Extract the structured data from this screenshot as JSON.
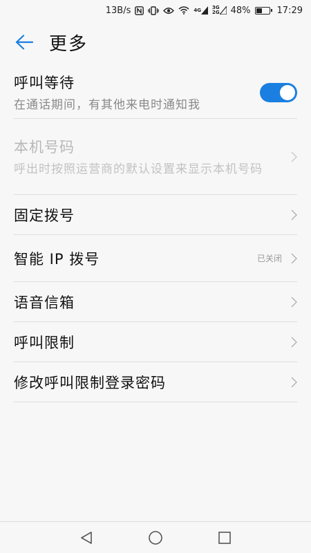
{
  "status_bar": {
    "net_speed": "13B/s",
    "net_4g_top": "4G",
    "net_3g_top": "3G",
    "net_3g_bottom": "2G",
    "battery_percent": "48%",
    "battery_level": 0.48,
    "time": "17:29"
  },
  "header": {
    "title": "更多"
  },
  "settings": [
    {
      "title": "呼叫等待",
      "subtitle": "在通话期间，有其他来电时通知我",
      "toggle_on": true
    },
    {
      "title": "本机号码",
      "subtitle": "呼出时按照运营商的默认设置来显示本机号码",
      "disabled": true
    },
    {
      "title": "固定拨号"
    },
    {
      "title": "智能 IP 拨号",
      "status": "已关闭"
    },
    {
      "title": "语音信箱"
    },
    {
      "title": "呼叫限制"
    },
    {
      "title": "修改呼叫限制登录密码"
    }
  ],
  "colors": {
    "accent": "#1a7fe0",
    "background": "#f7f7f7",
    "divider": "#dedede"
  },
  "icons": {
    "back": "arrow-left-icon",
    "chevron": "chevron-right-icon",
    "nav_back": "triangle-back-icon",
    "nav_home": "circle-home-icon",
    "nav_recent": "square-recent-icon"
  }
}
